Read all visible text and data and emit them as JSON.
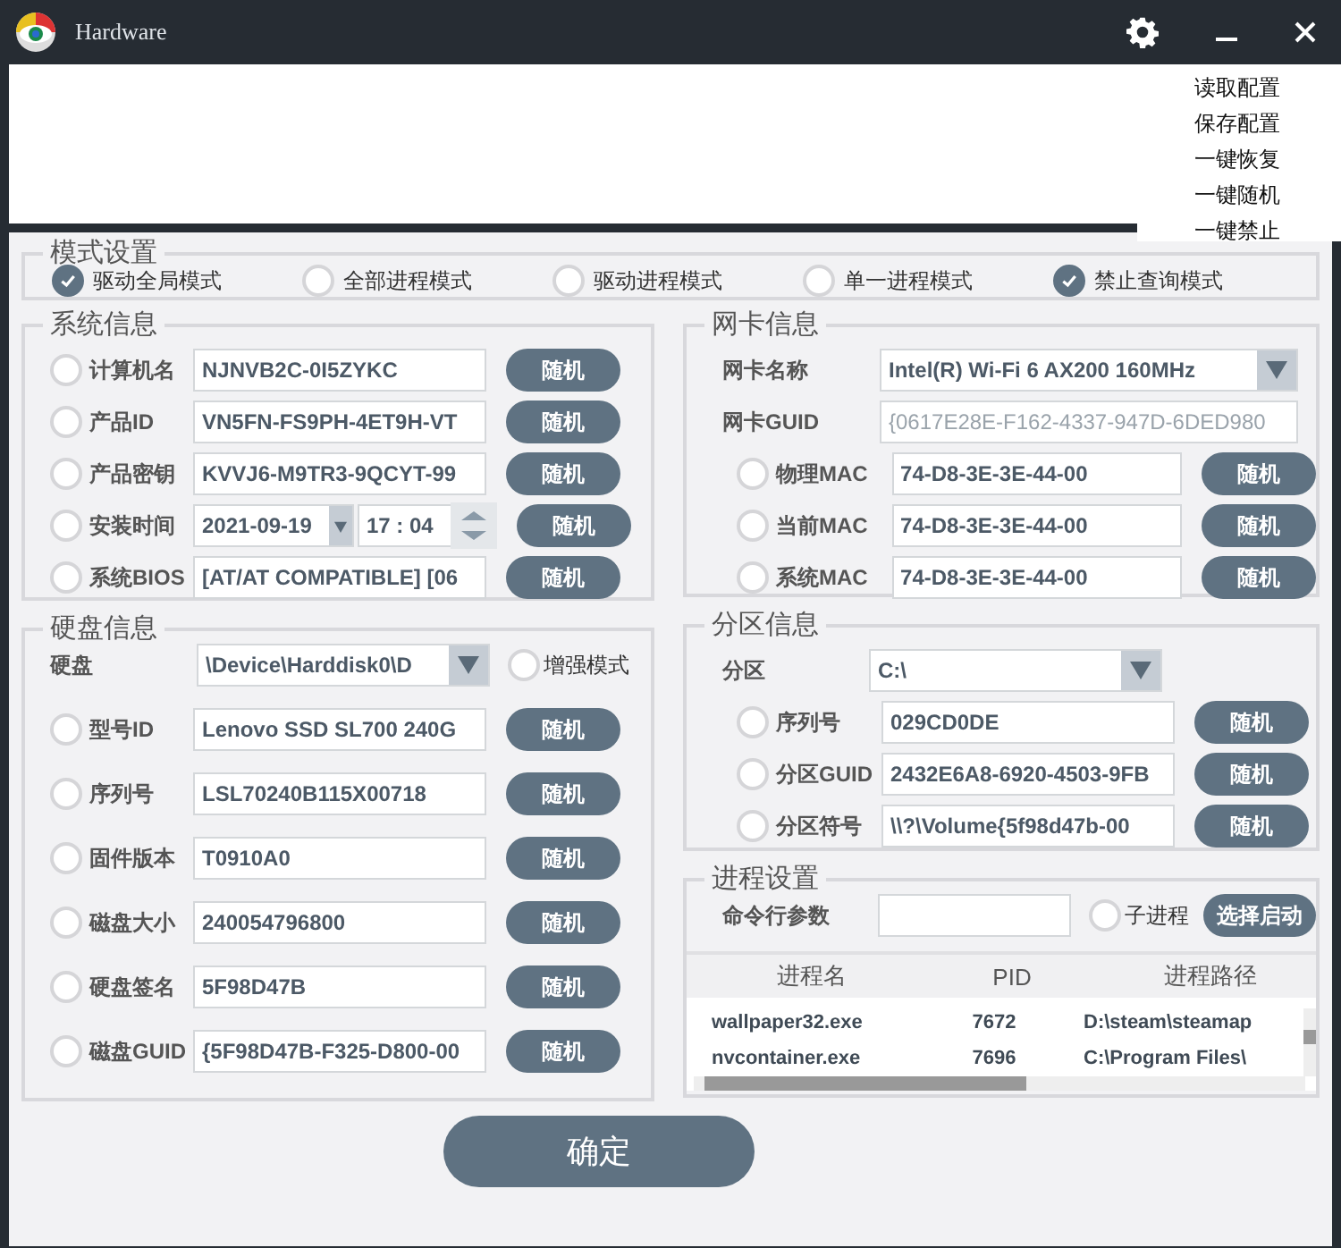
{
  "window": {
    "title": "Hardware"
  },
  "menu": {
    "items": [
      "读取配置",
      "保存配置",
      "一键恢复",
      "一键随机",
      "一键禁止"
    ]
  },
  "mode": {
    "legend": "模式设置",
    "options": [
      {
        "label": "驱动全局模式",
        "checked": true
      },
      {
        "label": "全部进程模式",
        "checked": false
      },
      {
        "label": "驱动进程模式",
        "checked": false
      },
      {
        "label": "单一进程模式",
        "checked": false
      },
      {
        "label": "禁止查询模式",
        "checked": true
      }
    ]
  },
  "system": {
    "legend": "系统信息",
    "rows": [
      {
        "kind": "text",
        "label": "计算机名",
        "value": "NJNVB2C-0I5ZYKC",
        "checked": false,
        "button": "随机"
      },
      {
        "kind": "text",
        "label": "产品ID",
        "value": "VN5FN-FS9PH-4ET9H-VT",
        "checked": false,
        "button": "随机"
      },
      {
        "kind": "text",
        "label": "产品密钥",
        "value": "KVVJ6-M9TR3-9QCYT-99",
        "checked": false,
        "button": "随机"
      },
      {
        "kind": "datetime",
        "label": "安装时间",
        "date": "2021-09-19",
        "time": "17 : 04",
        "checked": false,
        "button": "随机"
      },
      {
        "kind": "text",
        "label": "系统BIOS",
        "value": "[AT/AT COMPATIBLE] [06",
        "checked": false,
        "button": "随机"
      }
    ]
  },
  "network": {
    "legend": "网卡信息",
    "name_label": "网卡名称",
    "name_value": "Intel(R) Wi-Fi 6 AX200 160MHz",
    "guid_label": "网卡GUID",
    "guid_value": "{0617E28E-F162-4337-947D-6DED980",
    "rows": [
      {
        "label": "物理MAC",
        "value": "74-D8-3E-3E-44-00",
        "checked": false,
        "button": "随机"
      },
      {
        "label": "当前MAC",
        "value": "74-D8-3E-3E-44-00",
        "checked": false,
        "button": "随机"
      },
      {
        "label": "系统MAC",
        "value": "74-D8-3E-3E-44-00",
        "checked": false,
        "button": "随机"
      }
    ]
  },
  "disk": {
    "legend": "硬盘信息",
    "disk_label": "硬盘",
    "disk_value": "\\Device\\Harddisk0\\D",
    "enhanced": {
      "label": "增强模式",
      "checked": false
    },
    "rows": [
      {
        "label": "型号ID",
        "value": "Lenovo SSD SL700 240G",
        "checked": false,
        "button": "随机"
      },
      {
        "label": "序列号",
        "value": "LSL70240B115X00718",
        "checked": false,
        "button": "随机"
      },
      {
        "label": "固件版本",
        "value": "T0910A0",
        "checked": false,
        "button": "随机"
      },
      {
        "label": "磁盘大小",
        "value": "240054796800",
        "checked": false,
        "button": "随机"
      },
      {
        "label": "硬盘签名",
        "value": "5F98D47B",
        "checked": false,
        "button": "随机"
      },
      {
        "label": "磁盘GUID",
        "value": "{5F98D47B-F325-D800-00",
        "checked": false,
        "button": "随机"
      }
    ]
  },
  "partition": {
    "legend": "分区信息",
    "part_label": "分区",
    "part_value": "C:\\",
    "rows": [
      {
        "label": "序列号",
        "value": "029CD0DE",
        "checked": false,
        "button": "随机"
      },
      {
        "label": "分区GUID",
        "value": "2432E6A8-6920-4503-9FB",
        "checked": false,
        "button": "随机"
      },
      {
        "label": "分区符号",
        "value": "\\\\?\\Volume{5f98d47b-00",
        "checked": false,
        "button": "随机"
      }
    ]
  },
  "process": {
    "legend": "进程设置",
    "cmd_label": "命令行参数",
    "child": {
      "label": "子进程",
      "checked": false
    },
    "start_button": "选择启动",
    "table": {
      "columns": [
        "进程名",
        "PID",
        "进程路径"
      ],
      "rows": [
        [
          "wallpaper32.exe",
          "7672",
          "D:\\steam\\steamap"
        ],
        [
          "nvcontainer.exe",
          "7696",
          "C:\\Program Files\\"
        ]
      ]
    }
  },
  "confirm": "确定"
}
